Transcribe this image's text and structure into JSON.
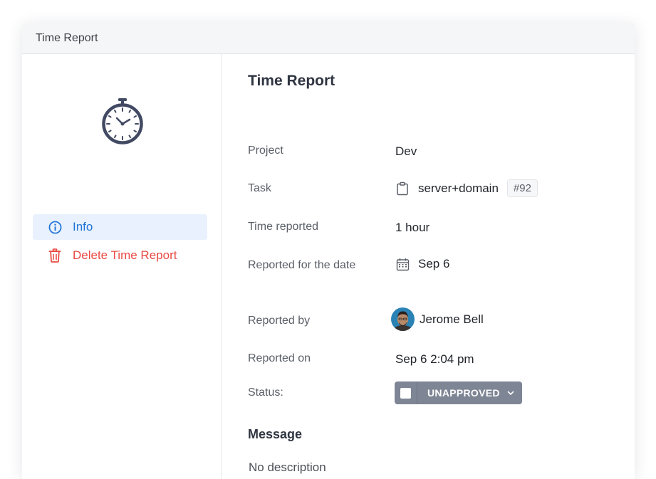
{
  "window": {
    "title": "Time Report"
  },
  "sidebar": {
    "icon": "stopwatch-icon",
    "items": [
      {
        "label": "Info",
        "icon": "info-icon",
        "active": true,
        "color": "#1f73d8"
      },
      {
        "label": "Delete Time Report",
        "icon": "trash-icon",
        "active": false,
        "color": "#e84a43"
      }
    ]
  },
  "report": {
    "heading": "Time Report",
    "project_label": "Project",
    "project_value": "Dev",
    "task_label": "Task",
    "task_icon": "clipboard-icon",
    "task_value": "server+domain",
    "task_badge": "#92",
    "time_label": "Time reported",
    "time_value": "1 hour",
    "date_label": "Reported for the date",
    "date_icon": "calendar-icon",
    "date_value": "Sep 6",
    "reported_by_label": "Reported by",
    "reported_by_value": "Jerome Bell",
    "reported_on_label": "Reported on",
    "reported_on_value": "Sep 6 2:04 pm",
    "status_label": "Status:",
    "status_value": "UNAPPROVED",
    "status_color": "#7e8594"
  },
  "message": {
    "heading": "Message",
    "text": "No description"
  }
}
